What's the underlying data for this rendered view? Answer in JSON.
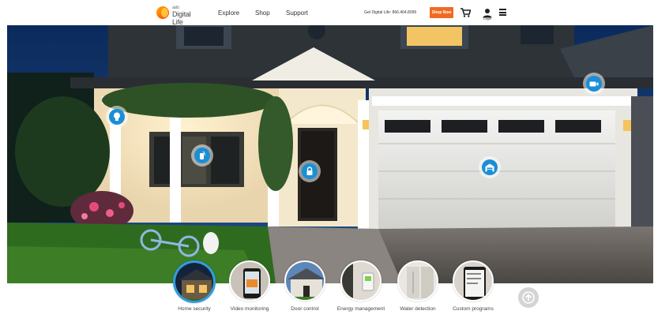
{
  "header": {
    "logo_att": "at&t",
    "logo_name": "Digital Life",
    "nav": [
      "Explore",
      "Shop",
      "Support"
    ],
    "phone_text": "Get Digital Life: 866.464.8099",
    "shop_now_label": "Shop Now",
    "login_label": "Login"
  },
  "hotspots": [
    {
      "name": "light-hotspot",
      "icon": "lightbulb-icon"
    },
    {
      "name": "window-sensor-hotspot",
      "icon": "sensor-icon"
    },
    {
      "name": "door-lock-hotspot",
      "icon": "lock-icon"
    },
    {
      "name": "garage-hotspot",
      "icon": "garage-icon"
    },
    {
      "name": "camera-hotspot",
      "icon": "camera-icon"
    }
  ],
  "categories": [
    {
      "label": "Home security",
      "active": true
    },
    {
      "label": "Video monitoring",
      "active": false
    },
    {
      "label": "Door control",
      "active": false
    },
    {
      "label": "Energy management",
      "active": false
    },
    {
      "label": "Water detection",
      "active": false
    },
    {
      "label": "Custom programs",
      "active": false
    }
  ],
  "colors": {
    "accent": "#1a8fd6",
    "active_ring": "#2a9fe0",
    "shop_now": "#f26a21"
  }
}
